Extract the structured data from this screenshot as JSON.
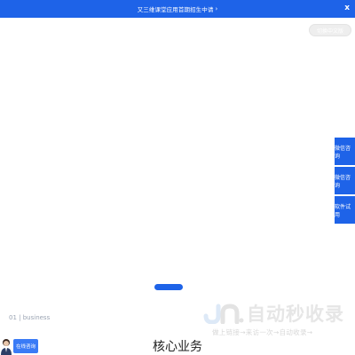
{
  "banner": {
    "text": "又三维课堂应用首期招生中请",
    "arrow": "›",
    "close": "x"
  },
  "pill_button": {
    "label": "切换中文版"
  },
  "side_tabs": [
    {
      "label": "微信咨询"
    },
    {
      "label": "微信咨询"
    },
    {
      "label": "软件试用"
    }
  ],
  "section": {
    "number": "01 | business",
    "title": "核心业务"
  },
  "watermark": {
    "title": "自动秒收录",
    "slogan": "做上链接→来访一次→自动收录→"
  },
  "chat": {
    "label": "在线咨询"
  },
  "colors": {
    "accent": "#1e63e8",
    "watermark": "#e6e6e6"
  }
}
